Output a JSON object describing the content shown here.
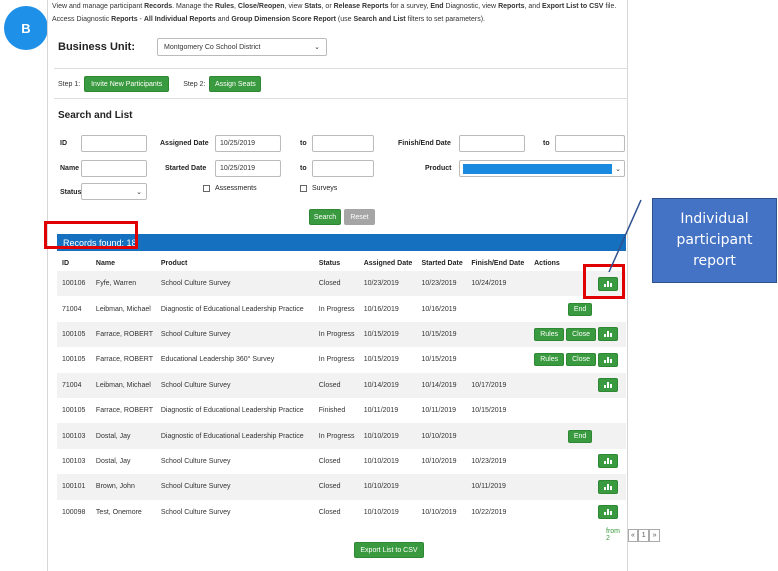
{
  "badge": "B",
  "intro": {
    "line1_parts": [
      "View and manage participant ",
      "Records",
      ". Manage the ",
      "Rules",
      ", ",
      "Close/Reopen",
      ", view ",
      "Stats",
      ", or ",
      "Release Reports",
      " for a survey, ",
      "End",
      " Diagnostic, view ",
      "Reports",
      ", and ",
      "Export List to CSV",
      " file."
    ],
    "line2_parts": [
      "Access Diagnostic ",
      "Reports",
      " - ",
      "All Individual Reports",
      " and ",
      "Group Dimension Score Report",
      " (use ",
      "Search and List",
      " filters to set parameters)."
    ]
  },
  "business_unit": {
    "label": "Business Unit:",
    "value": "Montgomery Co School District"
  },
  "steps": {
    "step1_label": "Step 1:",
    "step1_button": "Invite New Participants",
    "step2_label": "Step 2:",
    "step2_button": "Assign Seats"
  },
  "search": {
    "title": "Search and List",
    "id_label": "ID",
    "assigned_date_label": "Assigned Date",
    "assigned_from": "10/25/2019",
    "assigned_to_label": "to",
    "assigned_to": "",
    "finish_end_label": "Finish/End Date",
    "finish_from": "",
    "finish_to_label": "to",
    "finish_to": "",
    "name_label": "Name",
    "started_date_label": "Started Date",
    "started_from": "10/25/2019",
    "started_to_label": "to",
    "started_to": "",
    "product_label": "Product",
    "product_value": "",
    "status_label": "Status",
    "status_value": "",
    "assessments_label": "Assessments",
    "surveys_label": "Surveys",
    "search_button": "Search",
    "reset_button": "Reset"
  },
  "records_found": "Records found: 18",
  "table": {
    "headers": [
      "ID",
      "Name",
      "Product",
      "Status",
      "Assigned Date",
      "Started Date",
      "Finish/End Date",
      "Actions"
    ],
    "rows": [
      {
        "id": "100106",
        "name": "Fyfe, Warren",
        "product": "School Culture Survey",
        "status": "Closed",
        "assigned": "10/23/2019",
        "started": "10/23/2019",
        "finish": "10/24/2019",
        "actions": [
          "report"
        ]
      },
      {
        "id": "71004",
        "name": "Leibman, Michael",
        "product": "Diagnostic of Educational Leadership Practice",
        "status": "In Progress",
        "assigned": "10/16/2019",
        "started": "10/16/2019",
        "finish": "",
        "actions": [
          "End"
        ]
      },
      {
        "id": "100105",
        "name": "Farrace, ROBERT",
        "product": "School Culture Survey",
        "status": "In Progress",
        "assigned": "10/15/2019",
        "started": "10/15/2019",
        "finish": "",
        "actions": [
          "Rules",
          "Close",
          "report"
        ]
      },
      {
        "id": "100105",
        "name": "Farrace, ROBERT",
        "product": "Educational Leadership 360° Survey",
        "status": "In Progress",
        "assigned": "10/15/2019",
        "started": "10/15/2019",
        "finish": "",
        "actions": [
          "Rules",
          "Close",
          "report"
        ]
      },
      {
        "id": "71004",
        "name": "Leibman, Michael",
        "product": "School Culture Survey",
        "status": "Closed",
        "assigned": "10/14/2019",
        "started": "10/14/2019",
        "finish": "10/17/2019",
        "actions": [
          "report"
        ]
      },
      {
        "id": "100105",
        "name": "Farrace, ROBERT",
        "product": "Diagnostic of Educational Leadership Practice",
        "status": "Finished",
        "assigned": "10/11/2019",
        "started": "10/11/2019",
        "finish": "10/15/2019",
        "actions": []
      },
      {
        "id": "100103",
        "name": "Dostal, Jay",
        "product": "Diagnostic of Educational Leadership Practice",
        "status": "In Progress",
        "assigned": "10/10/2019",
        "started": "10/10/2019",
        "finish": "",
        "actions": [
          "End"
        ]
      },
      {
        "id": "100103",
        "name": "Dostal, Jay",
        "product": "School Culture Survey",
        "status": "Closed",
        "assigned": "10/10/2019",
        "started": "10/10/2019",
        "finish": "10/23/2019",
        "actions": [
          "report"
        ]
      },
      {
        "id": "100101",
        "name": "Brown, John",
        "product": "School Culture Survey",
        "status": "Closed",
        "assigned": "10/10/2019",
        "started": "",
        "finish": "10/11/2019",
        "actions": [
          "report"
        ]
      },
      {
        "id": "100098",
        "name": "Test, Onemore",
        "product": "School Culture Survey",
        "status": "Closed",
        "assigned": "10/10/2019",
        "started": "10/10/2019",
        "finish": "10/22/2019",
        "actions": [
          "report"
        ]
      }
    ]
  },
  "pager": {
    "label": "from 2",
    "prev": "«",
    "page": "1",
    "next": "»"
  },
  "export_button": "Export List to CSV",
  "callout": "Individual participant report",
  "colors": {
    "primary_blue": "#1570c0",
    "green": "#3a9a3f",
    "highlight_red": "#e00000",
    "callout_blue": "#4472c4"
  }
}
